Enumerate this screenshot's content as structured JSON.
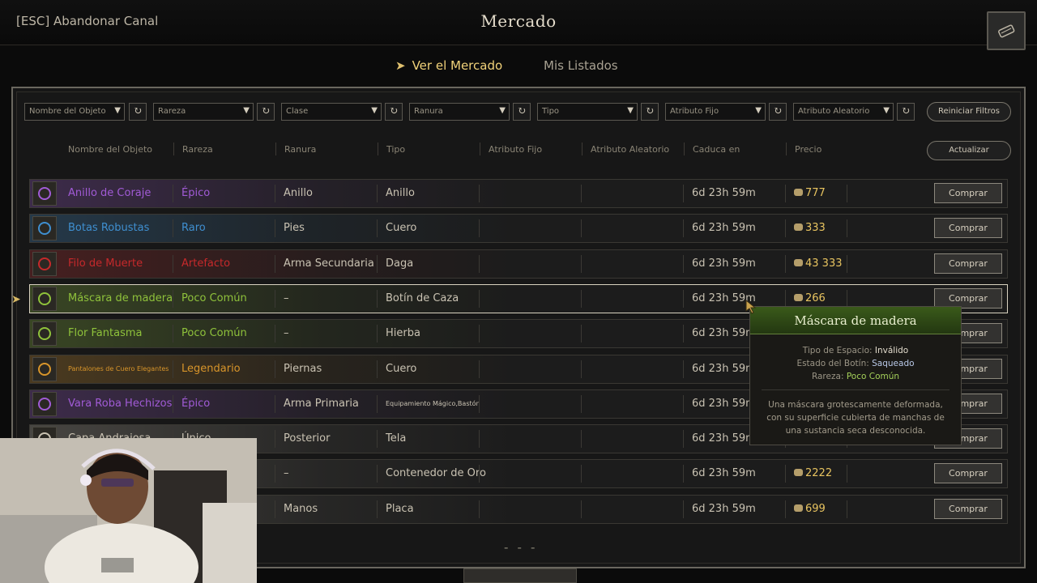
{
  "header": {
    "esc_label": "[ESC] Abandonar Canal",
    "title": "Mercado"
  },
  "tabs": [
    {
      "label": "Ver el Mercado",
      "active": true
    },
    {
      "label": "Mis Listados",
      "active": false
    }
  ],
  "filters": [
    {
      "label": "Nombre del Objeto"
    },
    {
      "label": "Rareza"
    },
    {
      "label": "Clase"
    },
    {
      "label": "Ranura"
    },
    {
      "label": "Tipo"
    },
    {
      "label": "Atributo Fijo"
    },
    {
      "label": "Atributo Aleatorio"
    }
  ],
  "reset_filters_label": "Reiniciar Filtros",
  "columns": [
    "Nombre del Objeto",
    "Rareza",
    "Ranura",
    "Tipo",
    "Atributo Fijo",
    "Atributo Aleatorio",
    "Caduca en",
    "Precio"
  ],
  "update_label": "Actualizar",
  "buy_label": "Comprar",
  "rows": [
    {
      "name": "Anillo de Coraje",
      "rarity": "Épico",
      "slot": "Anillo",
      "type": "Anillo",
      "expires": "6d 23h 59m",
      "price": "777",
      "color": "#a15bd6"
    },
    {
      "name": "Botas Robustas",
      "rarity": "Raro",
      "slot": "Pies",
      "type": "Cuero",
      "expires": "6d 23h 59m",
      "price": "333",
      "color": "#3f8fd0"
    },
    {
      "name": "Filo de Muerte",
      "rarity": "Artefacto",
      "slot": "Arma Secundaria",
      "type": "Daga",
      "expires": "6d 23h 59m",
      "price": "43 333",
      "color": "#c6292b"
    },
    {
      "name": "Máscara de madera",
      "rarity": "Poco Común",
      "slot": "–",
      "type": "Botín de Caza",
      "expires": "6d 23h 59m",
      "price": "266",
      "color": "#8fc23b"
    },
    {
      "name": "Flor Fantasma",
      "rarity": "Poco Común",
      "slot": "–",
      "type": "Hierba",
      "expires": "6d 23h 59m",
      "price": "",
      "color": "#8fc23b"
    },
    {
      "name": "Pantalones de Cuero Elegantes",
      "rarity": "Legendario",
      "slot": "Piernas",
      "type": "Cuero",
      "expires": "6d 23h 59m",
      "price": "",
      "color": "#d8952a"
    },
    {
      "name": "Vara Roba Hechizos",
      "rarity": "Épico",
      "slot": "Arma Primaria",
      "type": "Equipamiento Mágico,Bastón",
      "expires": "6d 23h 59m",
      "price": "",
      "color": "#a15bd6"
    },
    {
      "name": "Capa Andrajosa",
      "rarity": "Único",
      "slot": "Posterior",
      "type": "Tela",
      "expires": "6d 23h 59m",
      "price": "",
      "color": "#c9c2b2"
    },
    {
      "name": "",
      "rarity": "",
      "slot": "–",
      "type": "Contenedor de Oro",
      "expires": "6d 23h 59m",
      "price": "2222",
      "color": "#c9c2b2"
    },
    {
      "name": "",
      "rarity": "",
      "slot": "Manos",
      "type": "Placa",
      "expires": "6d 23h 59m",
      "price": "699",
      "color": "#c9c2b2"
    }
  ],
  "tooltip": {
    "title": "Máscara de madera",
    "slot_label": "Tipo de Espacio",
    "slot_value": "Inválido",
    "loot_label": "Estado del Botín",
    "loot_value": "Saqueado",
    "rarity_label": "Rareza",
    "rarity_value": "Poco Común",
    "description": "Una máscara grotescamente deformada, con su superficie cubierta de manchas de una sustancia seca desconocida."
  },
  "pager": "- - -"
}
